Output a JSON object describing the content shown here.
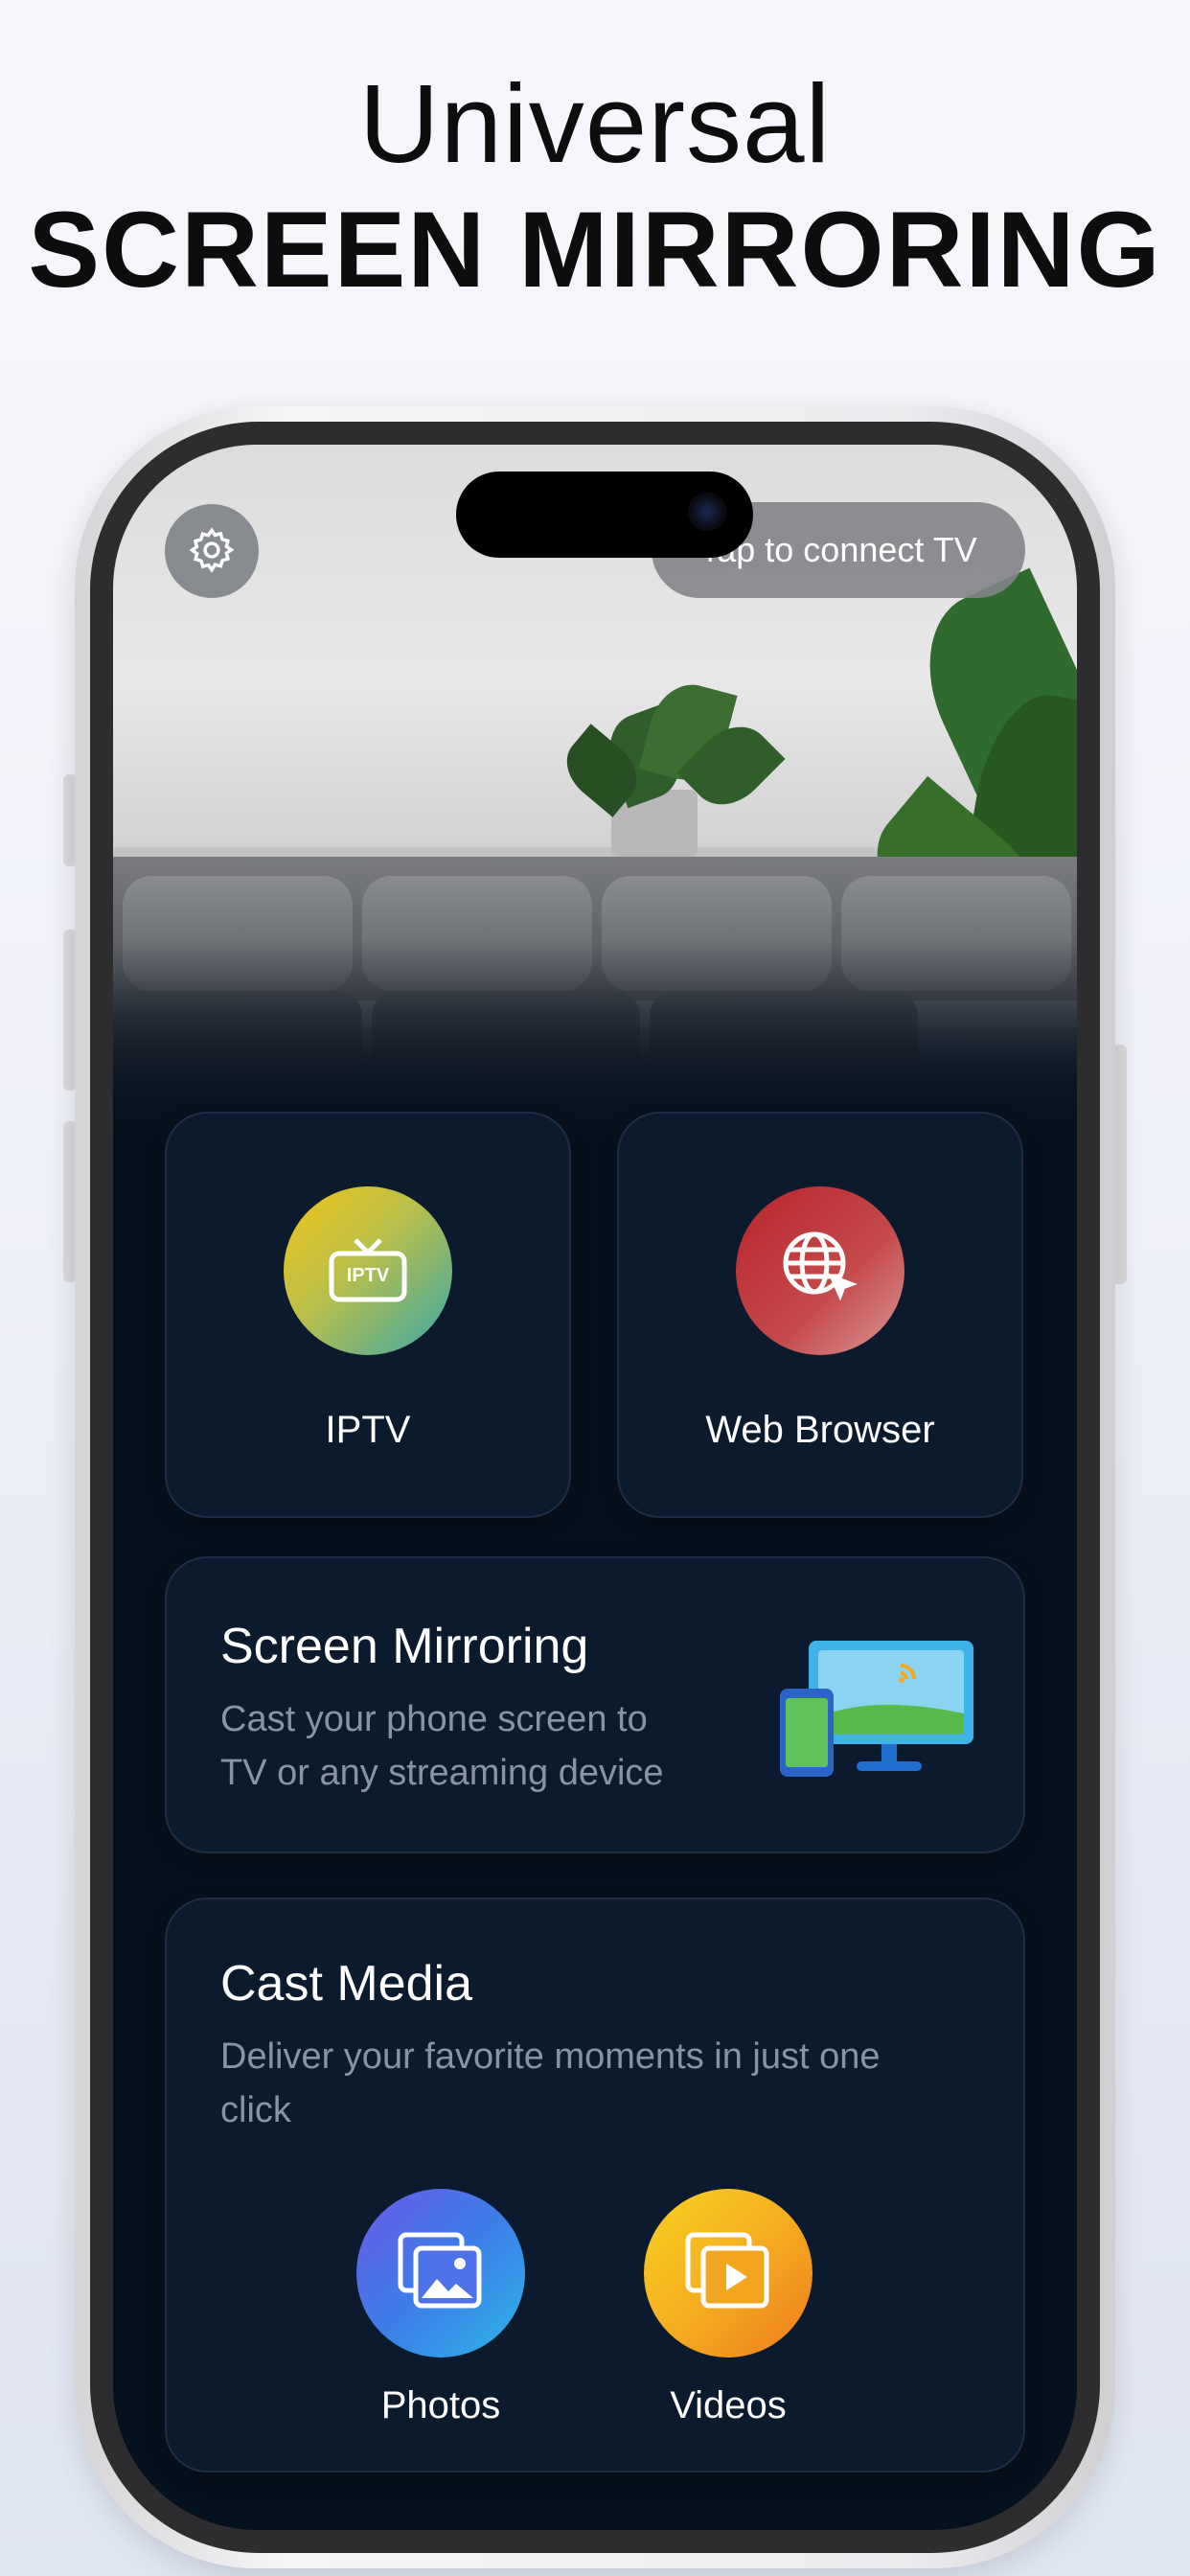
{
  "headline": {
    "line1": "Universal",
    "line2": "SCREEN MIRRORING"
  },
  "header": {
    "settings_icon": "gear-icon",
    "connect_label": "Tap to connect TV"
  },
  "tiles": [
    {
      "label": "IPTV",
      "icon": "tv-icon",
      "icon_text": "IPTV"
    },
    {
      "label": "Web Browser",
      "icon": "globe-cursor-icon"
    }
  ],
  "screen_mirroring": {
    "title": "Screen Mirroring",
    "description_line1": "Cast your phone screen to",
    "description_line2": "TV or any streaming device",
    "icon": "phone-to-monitor-icon"
  },
  "cast_media": {
    "title": "Cast Media",
    "description_line1": "Deliver your favorite moments in just one",
    "description_line2": "click",
    "buttons": [
      {
        "label": "Photos",
        "icon": "photos-icon"
      },
      {
        "label": "Videos",
        "icon": "video-play-icon"
      }
    ]
  },
  "colors": {
    "background": "#06111f",
    "card": "#0c1a2d",
    "muted_text": "#8994a3",
    "accent_blue": "#3d7de8",
    "accent_orange": "#f39a1e",
    "accent_red": "#c0393b"
  }
}
